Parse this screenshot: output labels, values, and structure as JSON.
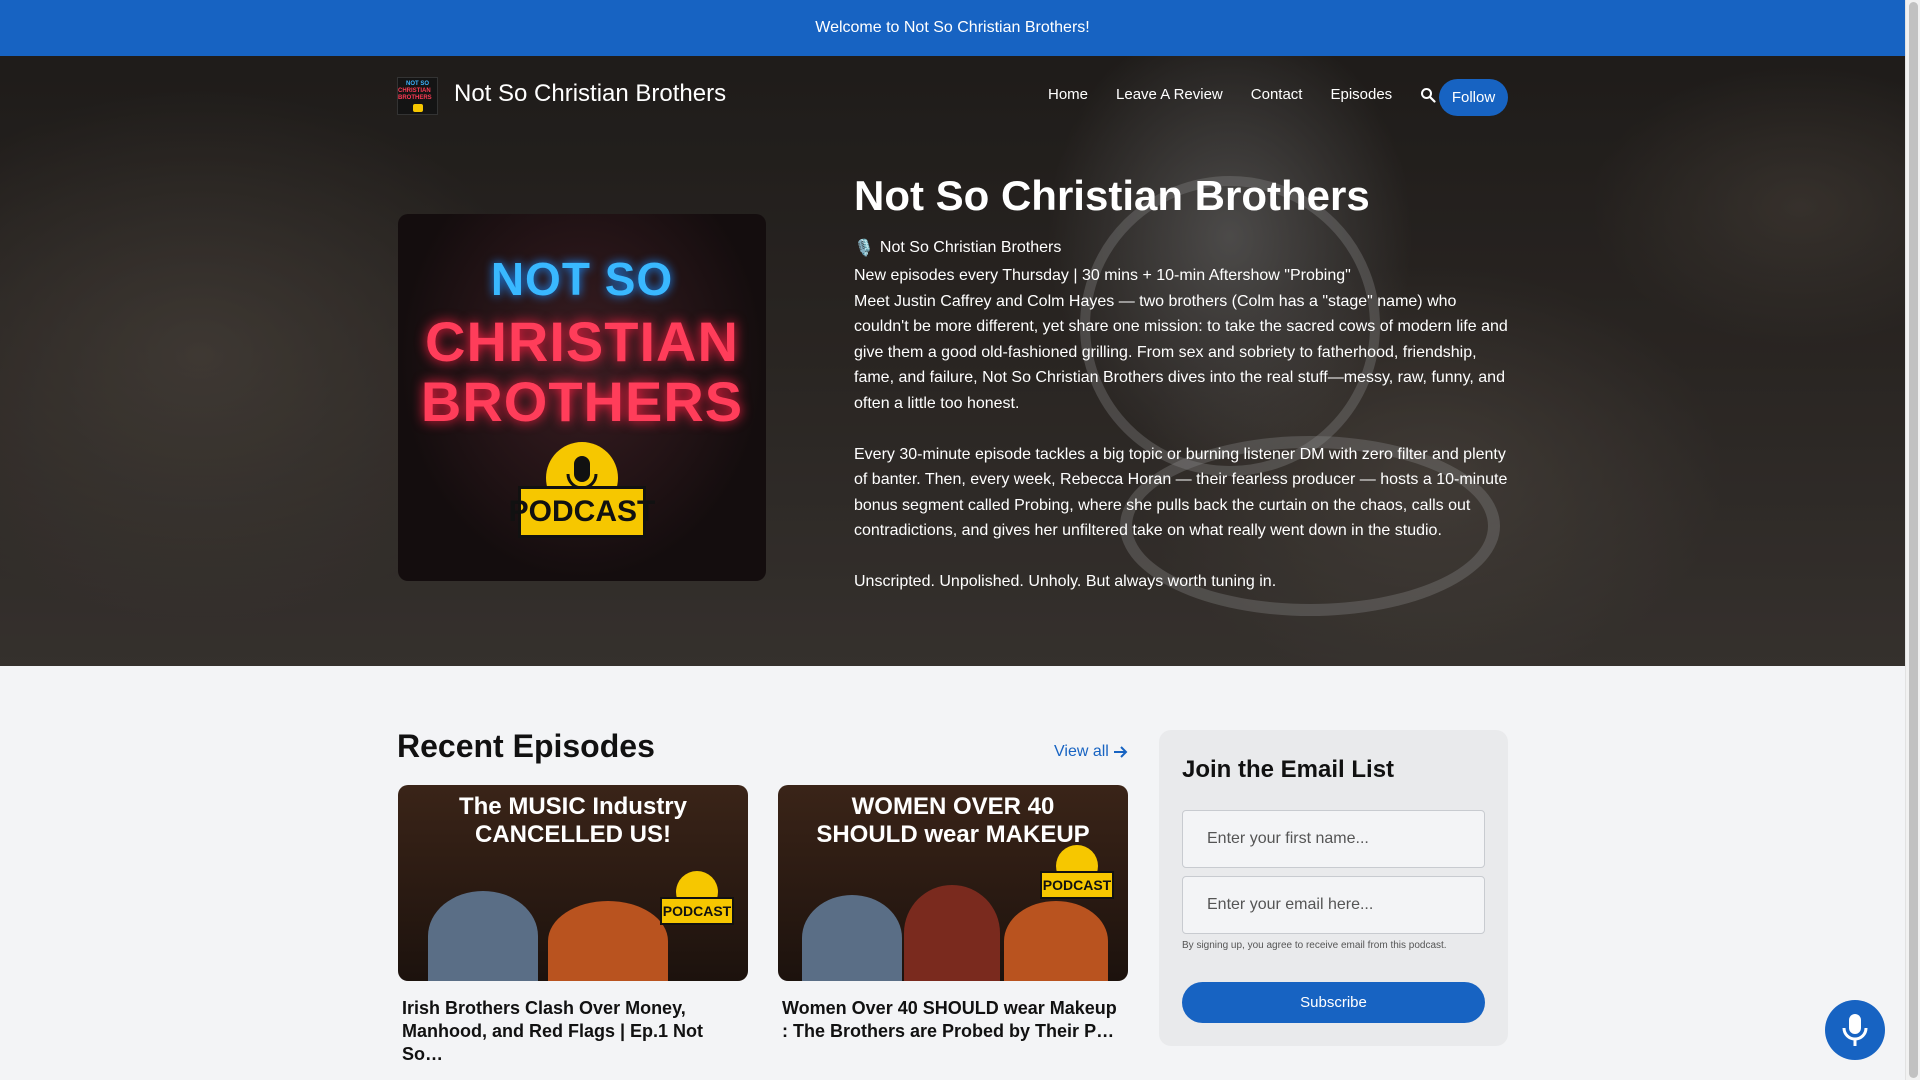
{
  "announcement": "Welcome to Not So Christian Brothers!",
  "header": {
    "site_title": "Not So Christian Brothers",
    "logo_text": [
      "NOT SO",
      "CHRISTIAN BROTHERS"
    ],
    "nav": [
      "Home",
      "Leave A Review",
      "Contact",
      "Episodes"
    ],
    "search_icon": "search-icon",
    "follow_label": "Follow"
  },
  "hero": {
    "cover_lines": [
      "NOT SO",
      "CHRISTIAN",
      "BROTHERS"
    ],
    "cover_badge": "PODCAST",
    "title": "Not So Christian Brothers",
    "subtitle_icon": "🎙️",
    "subtitle": "Not So Christian Brothers",
    "desc_line1": "New episodes every Thursday | 30 mins + 10-min Aftershow \"Probing\"",
    "desc_line2": "Meet Justin Caffrey and Colm Hayes — two brothers (Colm has a \"stage\" name) who couldn't be more different, yet share one mission: to take the sacred cows of modern life and give them a good old-fashioned grilling. From sex and sobriety to fatherhood, friendship, fame, and failure, Not So Christian Brothers dives into the real stuff—messy, raw, funny, and often a little too honest.",
    "desc_para2": "Every 30-minute episode tackles a big topic or burning listener DM with zero filter and plenty of banter. Then, every week, Rebecca Horan — their fearless producer — hosts a 10-minute bonus segment called Probing, where she pulls back the curtain on the chaos, calls out contradictions, and gives her unfiltered take on what really went down in the studio.",
    "desc_para3": "Unscripted. Unpolished. Unholy. But always worth tuning in."
  },
  "recent": {
    "title": "Recent Episodes",
    "view_all": "View all",
    "episodes": [
      {
        "thumb_headline": [
          "The MUSIC Industry",
          "CANCELLED US!"
        ],
        "thumb_badge": "PODCAST",
        "title": "Irish Brothers Clash Over Money, Manhood, and Red Flags | Ep.1 Not So…"
      },
      {
        "thumb_headline": [
          "WOMEN OVER 40",
          "SHOULD wear MAKEUP"
        ],
        "thumb_badge": "PODCAST",
        "title": "Women Over 40 SHOULD wear Makeup : The Brothers are Probed by Their P…"
      }
    ]
  },
  "email": {
    "title": "Join the Email List",
    "first_name_placeholder": "Enter your first name...",
    "email_placeholder": "Enter your email here...",
    "terms": "By signing up, you agree to receive email from this podcast.",
    "subscribe_label": "Subscribe"
  },
  "colors": {
    "accent": "#1763c2",
    "neon_blue": "#39b8ff",
    "neon_red": "#ff3d5a",
    "badge_yellow": "#f6c700"
  },
  "icons": {
    "fab": "microphone-icon",
    "view_all": "arrow-right-icon"
  }
}
